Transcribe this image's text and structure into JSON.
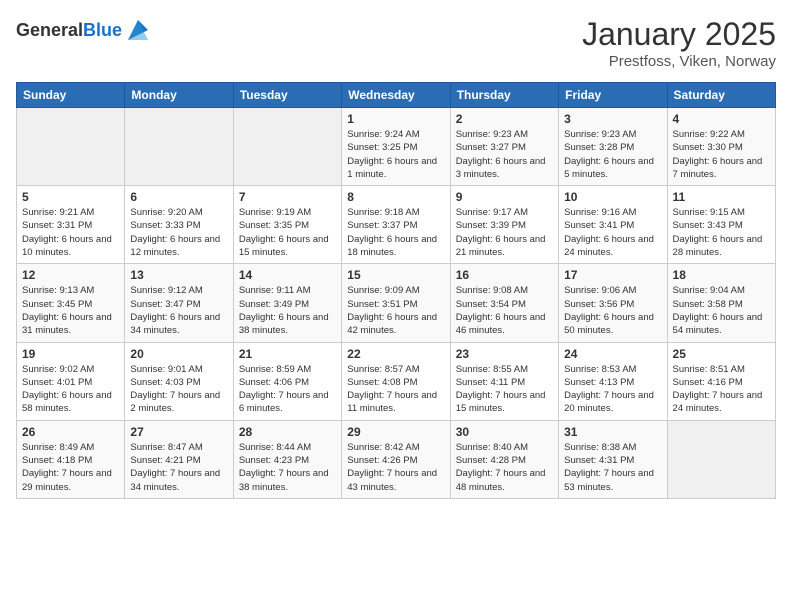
{
  "header": {
    "logo_general": "General",
    "logo_blue": "Blue",
    "month_year": "January 2025",
    "location": "Prestfoss, Viken, Norway"
  },
  "weekdays": [
    "Sunday",
    "Monday",
    "Tuesday",
    "Wednesday",
    "Thursday",
    "Friday",
    "Saturday"
  ],
  "weeks": [
    [
      {
        "day": "",
        "sunrise": "",
        "sunset": "",
        "daylight": ""
      },
      {
        "day": "",
        "sunrise": "",
        "sunset": "",
        "daylight": ""
      },
      {
        "day": "",
        "sunrise": "",
        "sunset": "",
        "daylight": ""
      },
      {
        "day": "1",
        "sunrise": "Sunrise: 9:24 AM",
        "sunset": "Sunset: 3:25 PM",
        "daylight": "Daylight: 6 hours and 1 minute."
      },
      {
        "day": "2",
        "sunrise": "Sunrise: 9:23 AM",
        "sunset": "Sunset: 3:27 PM",
        "daylight": "Daylight: 6 hours and 3 minutes."
      },
      {
        "day": "3",
        "sunrise": "Sunrise: 9:23 AM",
        "sunset": "Sunset: 3:28 PM",
        "daylight": "Daylight: 6 hours and 5 minutes."
      },
      {
        "day": "4",
        "sunrise": "Sunrise: 9:22 AM",
        "sunset": "Sunset: 3:30 PM",
        "daylight": "Daylight: 6 hours and 7 minutes."
      }
    ],
    [
      {
        "day": "5",
        "sunrise": "Sunrise: 9:21 AM",
        "sunset": "Sunset: 3:31 PM",
        "daylight": "Daylight: 6 hours and 10 minutes."
      },
      {
        "day": "6",
        "sunrise": "Sunrise: 9:20 AM",
        "sunset": "Sunset: 3:33 PM",
        "daylight": "Daylight: 6 hours and 12 minutes."
      },
      {
        "day": "7",
        "sunrise": "Sunrise: 9:19 AM",
        "sunset": "Sunset: 3:35 PM",
        "daylight": "Daylight: 6 hours and 15 minutes."
      },
      {
        "day": "8",
        "sunrise": "Sunrise: 9:18 AM",
        "sunset": "Sunset: 3:37 PM",
        "daylight": "Daylight: 6 hours and 18 minutes."
      },
      {
        "day": "9",
        "sunrise": "Sunrise: 9:17 AM",
        "sunset": "Sunset: 3:39 PM",
        "daylight": "Daylight: 6 hours and 21 minutes."
      },
      {
        "day": "10",
        "sunrise": "Sunrise: 9:16 AM",
        "sunset": "Sunset: 3:41 PM",
        "daylight": "Daylight: 6 hours and 24 minutes."
      },
      {
        "day": "11",
        "sunrise": "Sunrise: 9:15 AM",
        "sunset": "Sunset: 3:43 PM",
        "daylight": "Daylight: 6 hours and 28 minutes."
      }
    ],
    [
      {
        "day": "12",
        "sunrise": "Sunrise: 9:13 AM",
        "sunset": "Sunset: 3:45 PM",
        "daylight": "Daylight: 6 hours and 31 minutes."
      },
      {
        "day": "13",
        "sunrise": "Sunrise: 9:12 AM",
        "sunset": "Sunset: 3:47 PM",
        "daylight": "Daylight: 6 hours and 34 minutes."
      },
      {
        "day": "14",
        "sunrise": "Sunrise: 9:11 AM",
        "sunset": "Sunset: 3:49 PM",
        "daylight": "Daylight: 6 hours and 38 minutes."
      },
      {
        "day": "15",
        "sunrise": "Sunrise: 9:09 AM",
        "sunset": "Sunset: 3:51 PM",
        "daylight": "Daylight: 6 hours and 42 minutes."
      },
      {
        "day": "16",
        "sunrise": "Sunrise: 9:08 AM",
        "sunset": "Sunset: 3:54 PM",
        "daylight": "Daylight: 6 hours and 46 minutes."
      },
      {
        "day": "17",
        "sunrise": "Sunrise: 9:06 AM",
        "sunset": "Sunset: 3:56 PM",
        "daylight": "Daylight: 6 hours and 50 minutes."
      },
      {
        "day": "18",
        "sunrise": "Sunrise: 9:04 AM",
        "sunset": "Sunset: 3:58 PM",
        "daylight": "Daylight: 6 hours and 54 minutes."
      }
    ],
    [
      {
        "day": "19",
        "sunrise": "Sunrise: 9:02 AM",
        "sunset": "Sunset: 4:01 PM",
        "daylight": "Daylight: 6 hours and 58 minutes."
      },
      {
        "day": "20",
        "sunrise": "Sunrise: 9:01 AM",
        "sunset": "Sunset: 4:03 PM",
        "daylight": "Daylight: 7 hours and 2 minutes."
      },
      {
        "day": "21",
        "sunrise": "Sunrise: 8:59 AM",
        "sunset": "Sunset: 4:06 PM",
        "daylight": "Daylight: 7 hours and 6 minutes."
      },
      {
        "day": "22",
        "sunrise": "Sunrise: 8:57 AM",
        "sunset": "Sunset: 4:08 PM",
        "daylight": "Daylight: 7 hours and 11 minutes."
      },
      {
        "day": "23",
        "sunrise": "Sunrise: 8:55 AM",
        "sunset": "Sunset: 4:11 PM",
        "daylight": "Daylight: 7 hours and 15 minutes."
      },
      {
        "day": "24",
        "sunrise": "Sunrise: 8:53 AM",
        "sunset": "Sunset: 4:13 PM",
        "daylight": "Daylight: 7 hours and 20 minutes."
      },
      {
        "day": "25",
        "sunrise": "Sunrise: 8:51 AM",
        "sunset": "Sunset: 4:16 PM",
        "daylight": "Daylight: 7 hours and 24 minutes."
      }
    ],
    [
      {
        "day": "26",
        "sunrise": "Sunrise: 8:49 AM",
        "sunset": "Sunset: 4:18 PM",
        "daylight": "Daylight: 7 hours and 29 minutes."
      },
      {
        "day": "27",
        "sunrise": "Sunrise: 8:47 AM",
        "sunset": "Sunset: 4:21 PM",
        "daylight": "Daylight: 7 hours and 34 minutes."
      },
      {
        "day": "28",
        "sunrise": "Sunrise: 8:44 AM",
        "sunset": "Sunset: 4:23 PM",
        "daylight": "Daylight: 7 hours and 38 minutes."
      },
      {
        "day": "29",
        "sunrise": "Sunrise: 8:42 AM",
        "sunset": "Sunset: 4:26 PM",
        "daylight": "Daylight: 7 hours and 43 minutes."
      },
      {
        "day": "30",
        "sunrise": "Sunrise: 8:40 AM",
        "sunset": "Sunset: 4:28 PM",
        "daylight": "Daylight: 7 hours and 48 minutes."
      },
      {
        "day": "31",
        "sunrise": "Sunrise: 8:38 AM",
        "sunset": "Sunset: 4:31 PM",
        "daylight": "Daylight: 7 hours and 53 minutes."
      },
      {
        "day": "",
        "sunrise": "",
        "sunset": "",
        "daylight": ""
      }
    ]
  ]
}
